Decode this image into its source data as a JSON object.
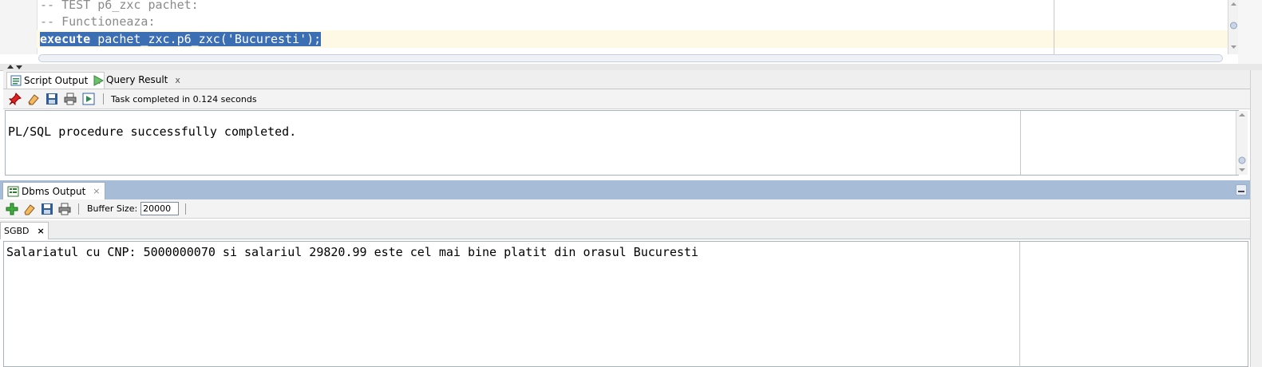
{
  "editor": {
    "lines": [
      {
        "text": "-- TEST p6_zxc pachet:",
        "kind": "comment"
      },
      {
        "text": "-- Functioneaza:",
        "kind": "comment"
      }
    ],
    "selected_keyword": "execute",
    "selected_rest": " pachet_zxc.p6_zxc('Bucuresti');"
  },
  "script_output": {
    "tabs": [
      {
        "label": "Script Output",
        "icon": "script-output-icon",
        "close": "x"
      },
      {
        "label": "Query Result",
        "icon": "run-play-icon",
        "close": "x"
      }
    ],
    "toolbar_icons": [
      "pin-icon",
      "eraser-icon",
      "save-disk-icon",
      "print-icon",
      "run-report-icon"
    ],
    "status": "Task completed in 0.124 seconds",
    "content": "PL/SQL procedure successfully completed."
  },
  "dbms_output": {
    "tab_label": "Dbms Output",
    "tab_close": "×",
    "toolbar_icons": [
      "add-connection-icon",
      "eraser-icon",
      "save-disk-icon",
      "print-icon"
    ],
    "buffer_label": "Buffer Size:",
    "buffer_value": "20000",
    "connection_tab": "SGBD",
    "connection_close": "×",
    "content": "Salariatul cu CNP: 5000000070 si salariul 29820.99 este cel mai bine platit din orasul Bucuresti"
  },
  "colors": {
    "selection": "#3c6eb4",
    "dbms_header": "#a7bcd6",
    "comment": "#8a8a8a"
  }
}
